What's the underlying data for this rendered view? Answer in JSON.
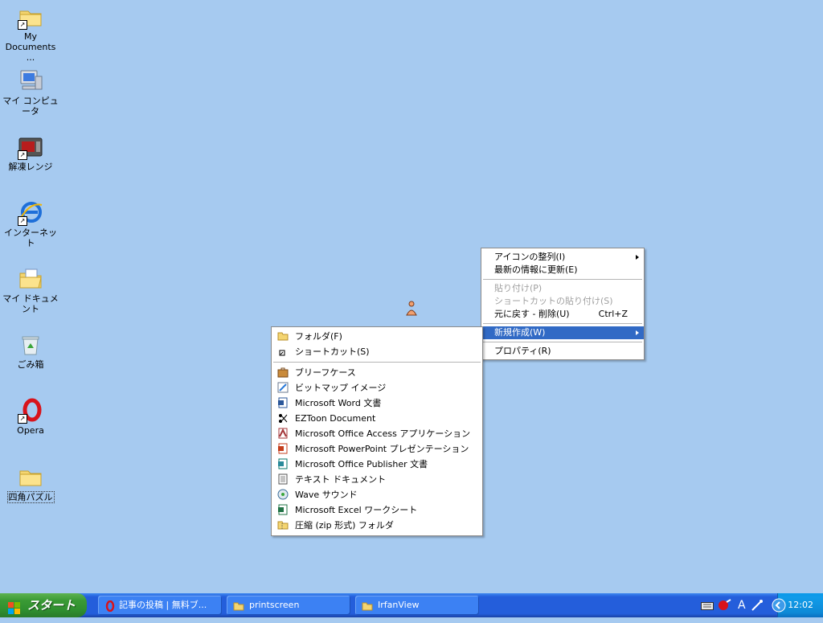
{
  "desktop": {
    "icons": [
      {
        "label": "My\nDocuments ...",
        "label1": "My",
        "label2": "Documents ..."
      },
      {
        "label": "マイ コンピュータ"
      },
      {
        "label": "解凍レンジ"
      },
      {
        "label": "インターネット"
      },
      {
        "label": "マイ ドキュメント"
      },
      {
        "label": "ごみ箱"
      },
      {
        "label": "Opera"
      },
      {
        "label": "四角パズル"
      }
    ]
  },
  "context_menu": {
    "items": [
      {
        "label": "アイコンの整列(I)",
        "submenu": true
      },
      {
        "label": "最新の情報に更新(E)"
      },
      {
        "label": "貼り付け(P)",
        "disabled": true
      },
      {
        "label": "ショートカットの貼り付け(S)",
        "disabled": true
      },
      {
        "label": "元に戻す - 削除(U)",
        "shortcut": "Ctrl+Z"
      },
      {
        "label": "新規作成(W)",
        "submenu": true,
        "selected": true
      },
      {
        "label": "プロパティ(R)"
      }
    ]
  },
  "new_submenu": {
    "items": [
      {
        "label": "フォルダ(F)",
        "icon": "folder-icon"
      },
      {
        "label": "ショートカット(S)",
        "icon": "shortcut-icon"
      },
      {
        "label": "ブリーフケース",
        "icon": "briefcase-icon"
      },
      {
        "label": "ビットマップ イメージ",
        "icon": "bitmap-icon"
      },
      {
        "label": "Microsoft Word 文書",
        "icon": "word-icon"
      },
      {
        "label": "EZToon Document",
        "icon": "eztoon-icon"
      },
      {
        "label": "Microsoft Office Access アプリケーション",
        "icon": "access-icon"
      },
      {
        "label": "Microsoft PowerPoint プレゼンテーション",
        "icon": "powerpoint-icon"
      },
      {
        "label": "Microsoft Office Publisher 文書",
        "icon": "publisher-icon"
      },
      {
        "label": "テキスト ドキュメント",
        "icon": "text-document-icon"
      },
      {
        "label": "Wave サウンド",
        "icon": "wave-sound-icon"
      },
      {
        "label": "Microsoft Excel ワークシート",
        "icon": "excel-icon"
      },
      {
        "label": "圧縮 (zip 形式) フォルダ",
        "icon": "zip-folder-icon"
      }
    ]
  },
  "taskbar": {
    "start_label": "スタート",
    "tasks": [
      {
        "label": "記事の投稿 | 無料ブ...",
        "icon": "opera-icon"
      },
      {
        "label": "printscreen",
        "icon": "folder-icon"
      },
      {
        "label": "IrfanView",
        "icon": "folder-icon"
      }
    ],
    "clock": "12:02"
  },
  "colors": {
    "desktop_bg": "#a6caf0",
    "menu_highlight": "#316ac5",
    "taskbar_blue": "#245edb",
    "start_green": "#3a9a35"
  }
}
